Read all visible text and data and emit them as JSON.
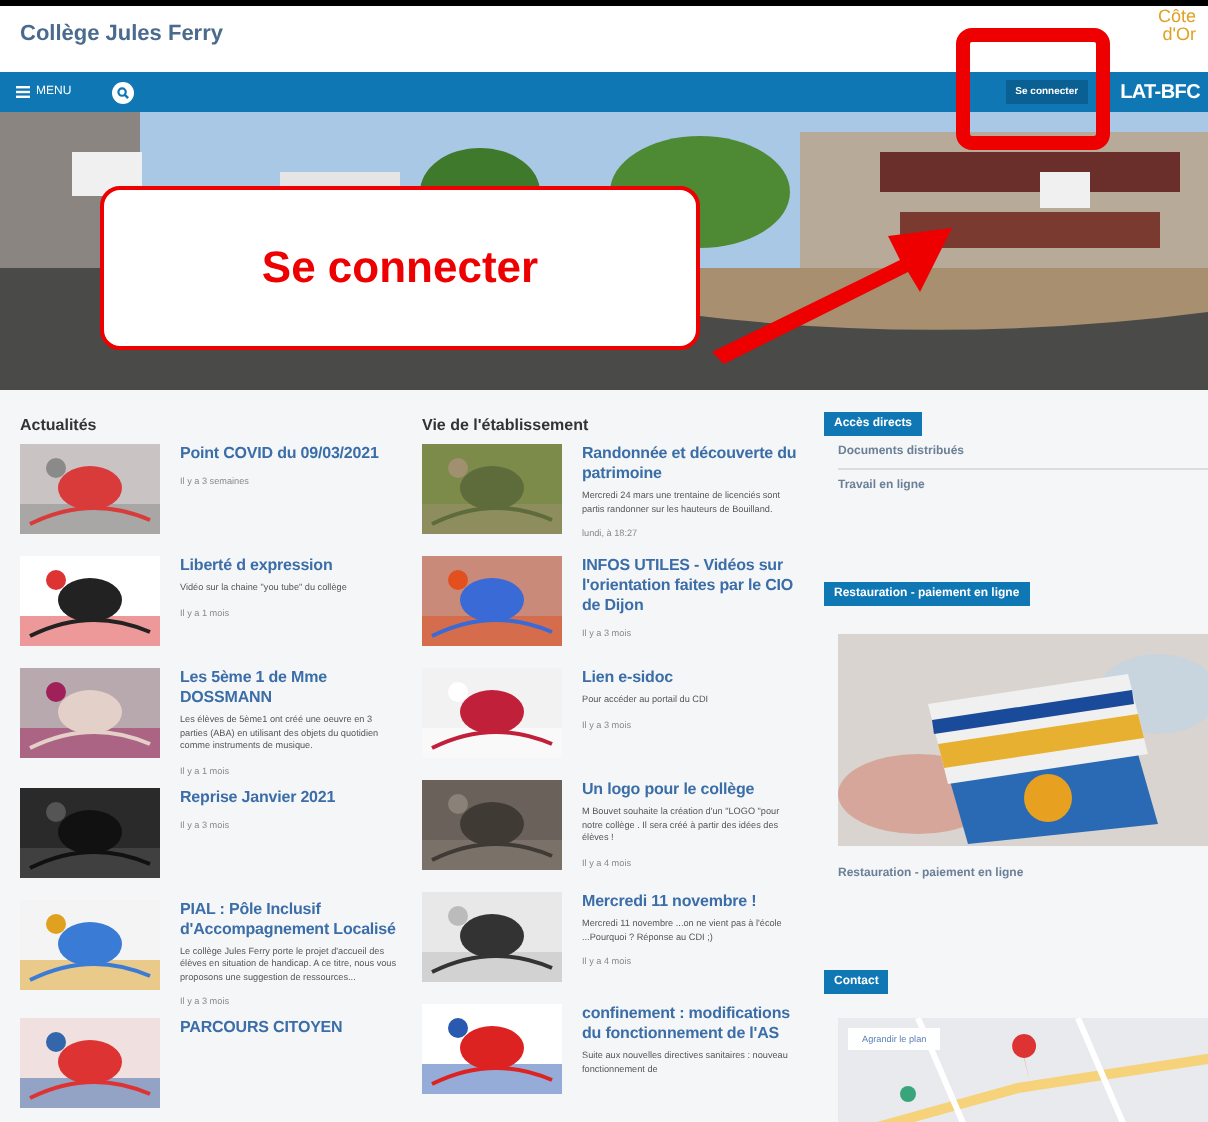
{
  "header": {
    "title": "Collège Jules Ferry",
    "logo_lines": [
      "Côte",
      "d'Or"
    ]
  },
  "nav": {
    "menu_label": "MENU",
    "login_button": "Se connecter",
    "brand": "LAT-BFC"
  },
  "annotation": {
    "callout": "Se connecter"
  },
  "news": {
    "heading": "Actualités",
    "items": [
      {
        "title": "Point COVID du 09/03/2021",
        "date": "Il y a 3 semaines"
      },
      {
        "title": "Liberté d expression",
        "summary": "Vidéo sur la chaine \"you tube\" du collège",
        "date": "Il y a 1 mois"
      },
      {
        "title": "Les 5ème 1 de Mme DOSSMANN",
        "summary": "Les élèves de 5ème1 ont créé une oeuvre en 3 parties (ABA) en utilisant des objets du quotidien comme instruments de musique.",
        "date": "Il y a 1 mois"
      },
      {
        "title": "Reprise Janvier 2021",
        "date": "Il y a 3 mois"
      },
      {
        "title": "PIAL : Pôle Inclusif d'Accompagnement Localisé",
        "summary": "Le collège Jules Ferry porte le projet d'accueil des élèves en situation de handicap. A ce titre, nous vous proposons une suggestion de ressources...",
        "date": "Il y a 3 mois"
      },
      {
        "title": "PARCOURS CITOYEN"
      }
    ]
  },
  "school_life": {
    "heading": "Vie de l'établissement",
    "items": [
      {
        "title": "Randonnée et découverte du patrimoine",
        "summary": "Mercredi 24 mars une trentaine de licenciés sont partis randonner sur les hauteurs de Bouilland.",
        "date": "lundi, à 18:27"
      },
      {
        "title": "INFOS UTILES - Vidéos sur l'orientation faites par le CIO de Dijon",
        "date": "Il y a 3 mois"
      },
      {
        "title": "Lien e-sidoc",
        "summary": "Pour accéder au portail du CDI",
        "date": "Il y a 3 mois"
      },
      {
        "title": "Un logo pour le collège",
        "summary": "M Bouvet souhaite la création d'un \"LOGO \"pour notre collège . Il sera créé à partir des idées des élèves !",
        "date": "Il y a 4 mois"
      },
      {
        "title": "Mercredi 11 novembre !",
        "summary": "Mercredi 11 novembre ...on ne vient pas à l'école ...Pourquoi ? Réponse au CDI ;)",
        "date": "Il y a 4 mois"
      },
      {
        "title": "confinement : modifications du fonctionnement de l'AS",
        "summary": "Suite aux nouvelles directives sanitaires : nouveau fonctionnement de"
      }
    ]
  },
  "sidebar": {
    "direct_access": {
      "heading": "Accès directs",
      "links": [
        "Documents distribués",
        "Travail en ligne"
      ]
    },
    "catering": {
      "heading": "Restauration - paiement en ligne",
      "caption": "Restauration - paiement en ligne"
    },
    "contact": {
      "heading": "Contact",
      "map_button": "Agrandir le plan"
    }
  }
}
